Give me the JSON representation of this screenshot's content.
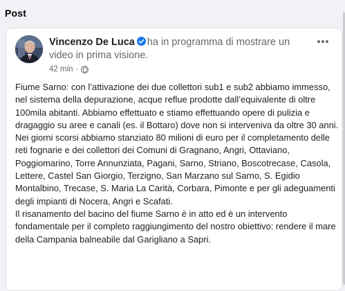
{
  "section": {
    "title": "Post"
  },
  "post": {
    "author_name": "Vincenzo De Luca",
    "action_text": "ha in programma di mostrare un video in prima visione.",
    "timestamp": "42 min",
    "separator": "·",
    "audience_icon": "globe-icon",
    "verified_icon": "verified-badge-icon",
    "more_icon": "more-options-icon",
    "paragraphs": [
      "Fiume Sarno: con l’attivazione dei due collettori sub1 e sub2 abbiamo immesso, nel sistema della depurazione, acque reflue prodotte dall’equivalente di oltre 100mila abitanti. Abbiamo effettuato e stiamo effettuando opere di pulizia e dragaggio su aree e canali (es. il Bottaro) dove non si interveniva da oltre 30 anni.",
      "Nei giorni scorsi abbiamo stanziato 80 milioni di euro per il completamento delle reti fognarie e dei collettori dei Comuni di Gragnano, Angri, Ottaviano, Poggiomarino, Torre Annunziata, Pagani, Sarno, Striano, Boscotrecase, Casola, Lettere, Castel San Giorgio, Terzigno, San Marzano sul Sarno, S. Egidio Montalbino, Trecase, S. Maria La Carità, Corbara, Pimonte e per gli adeguamenti degli impianti di Nocera, Angri e Scafati.",
      "Il risanamento del bacino del fiume Sarno è in atto ed è un intervento fondamentale per il completo raggiungimento del nostro obiettivo: rendere il mare della Campania balneabile dal Garigliano a Sapri."
    ]
  },
  "colors": {
    "page_background": "#f0f2f5",
    "card_background": "#ffffff",
    "primary_text": "#1c1e21",
    "secondary_text": "#65676b",
    "verified_blue": "#1877f2"
  }
}
